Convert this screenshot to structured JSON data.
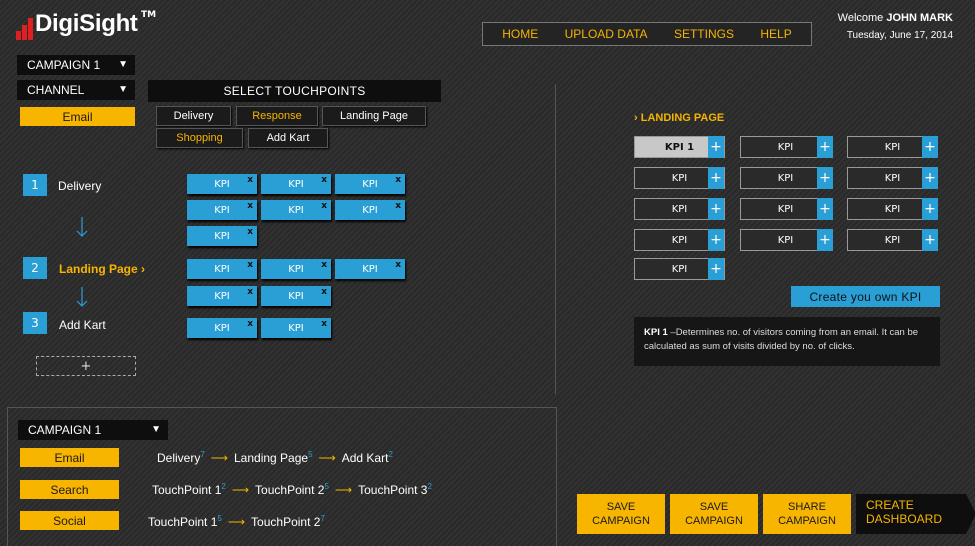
{
  "brand": {
    "name": "DigiSight",
    "tm": "TM",
    "bar_color": "#e02020"
  },
  "nav": {
    "items": [
      "HOME",
      "UPLOAD DATA",
      "SETTINGS",
      "HELP"
    ]
  },
  "user": {
    "welcome": "Welcome",
    "name": "JOHN MARK",
    "date": "Tuesday, June 17, 2014"
  },
  "filters": {
    "campaign": "CAMPAIGN  1",
    "channel": "CHANNEL",
    "channel_button": "Email"
  },
  "touchpoints": {
    "header": "SELECT TOUCHPOINTS",
    "items": [
      {
        "label": "Delivery",
        "active": false
      },
      {
        "label": "Response",
        "active": true
      },
      {
        "label": "Landing Page",
        "active": false
      },
      {
        "label": "Shopping",
        "active": true
      },
      {
        "label": "Add Kart",
        "active": false
      }
    ]
  },
  "steps": [
    {
      "num": "1",
      "label": "Delivery",
      "kpis": [
        "KPI",
        "KPI",
        "KPI",
        "KPI",
        "KPI",
        "KPI",
        "KPI"
      ]
    },
    {
      "num": "2",
      "label": "Landing Page",
      "arrow": "›",
      "kpis": [
        "KPI",
        "KPI",
        "KPI",
        "KPI",
        "KPI"
      ]
    },
    {
      "num": "3",
      "label": "Add Kart",
      "kpis": [
        "KPI",
        "KPI"
      ]
    }
  ],
  "kpi_remove": "x",
  "add_step": "+",
  "summary": {
    "campaign": "CAMPAIGN  1",
    "rows": [
      {
        "button": "Email",
        "flow": [
          {
            "t": "Delivery",
            "s": "7"
          },
          {
            "t": "Landing  Page",
            "s": "5"
          },
          {
            "t": "Add Kart",
            "s": "2"
          }
        ]
      },
      {
        "button": "Search",
        "flow": [
          {
            "t": "TouchPoint  1",
            "s": "2"
          },
          {
            "t": "TouchPoint  2",
            "s": "5"
          },
          {
            "t": "TouchPoint  3",
            "s": "2"
          }
        ]
      },
      {
        "button": "Social",
        "flow": [
          {
            "t": "TouchPoint  1",
            "s": "5"
          },
          {
            "t": "TouchPoint  2",
            "s": "7"
          }
        ]
      }
    ]
  },
  "kpi_panel": {
    "title": "LANDING PAGE",
    "plus": "+",
    "grid": [
      "KPI 1",
      "KPI",
      "KPI",
      "KPI",
      "KPI",
      "KPI",
      "KPI",
      "KPI",
      "KPI",
      "KPI",
      "KPI",
      "KPI",
      "KPI"
    ],
    "create_label": "Create  you  own KPI",
    "desc_term": "KPI 1",
    "desc_text": " –Determines no. of visitors coming  from an email.  It can be calculated as sum of visits divided by no. of clicks."
  },
  "actions": [
    "SAVE\nCAMPAIGN",
    "SAVE\nCAMPAIGN",
    "SHARE\nCAMPAIGN"
  ],
  "dashboard": "CREATE\nDASHBOARD",
  "colors": {
    "accent": "#f7b500",
    "blue": "#2a9fd6",
    "bg": "#2b2b2b"
  }
}
